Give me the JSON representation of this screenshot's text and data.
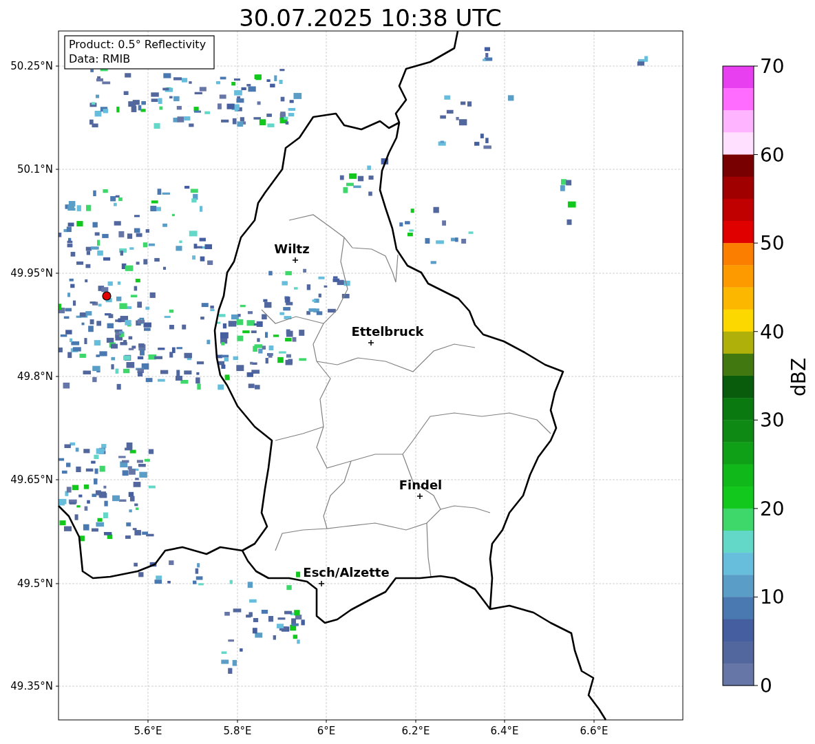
{
  "title": "30.07.2025 10:38 UTC",
  "info_box": [
    "Product: 0.5° Reflectivity",
    "Data: RMIB"
  ],
  "map": {
    "y_ticks": [
      "50.25°N",
      "50.1°N",
      "49.95°N",
      "49.8°N",
      "49.65°N",
      "49.5°N",
      "49.35°N"
    ],
    "x_ticks": [
      "5.6°E",
      "5.8°E",
      "6°E",
      "6.2°E",
      "6.4°E",
      "6.6°E"
    ],
    "places": [
      {
        "name": "Wiltz"
      },
      {
        "name": "Ettelbruck"
      },
      {
        "name": "Findel"
      },
      {
        "name": "Esch/Alzette"
      }
    ]
  },
  "colorbar": {
    "label": "dBZ",
    "ticks": [
      "70",
      "60",
      "50",
      "40",
      "30",
      "20",
      "10",
      "0"
    ],
    "bands": [
      {
        "color": "#e840f0"
      },
      {
        "color": "#ff6cff"
      },
      {
        "color": "#ffb4ff"
      },
      {
        "color": "#ffe0ff"
      },
      {
        "color": "#780000"
      },
      {
        "color": "#a00000"
      },
      {
        "color": "#c00000"
      },
      {
        "color": "#e00000"
      },
      {
        "color": "#fc7e00"
      },
      {
        "color": "#fc9a00"
      },
      {
        "color": "#fcb800"
      },
      {
        "color": "#fcd800"
      },
      {
        "color": "#b0b00a"
      },
      {
        "color": "#427810"
      },
      {
        "color": "#085c0c"
      },
      {
        "color": "#0a7a10"
      },
      {
        "color": "#0e8a14"
      },
      {
        "color": "#10a018"
      },
      {
        "color": "#10b81a"
      },
      {
        "color": "#12c81c"
      },
      {
        "color": "#3ed86a"
      },
      {
        "color": "#64d8c8"
      },
      {
        "color": "#66bedc"
      },
      {
        "color": "#5a9ec8"
      },
      {
        "color": "#4a78b0"
      },
      {
        "color": "#445ea0"
      },
      {
        "color": "#52679d"
      },
      {
        "color": "#6676a6"
      }
    ]
  }
}
